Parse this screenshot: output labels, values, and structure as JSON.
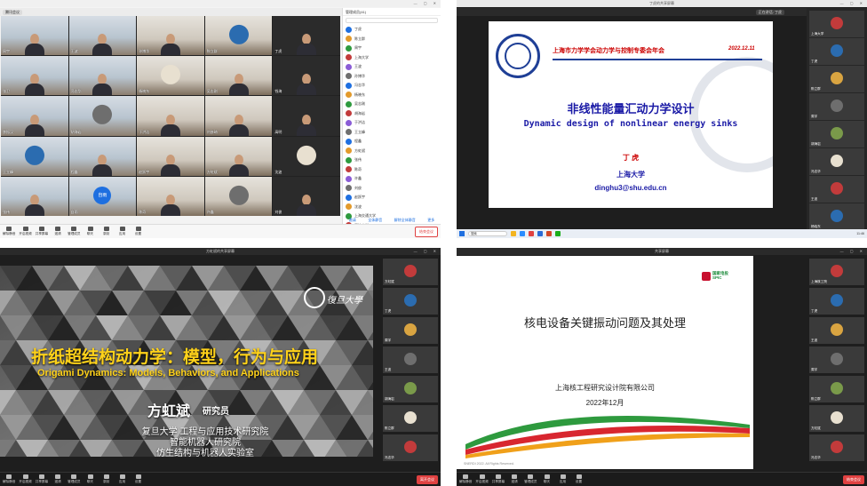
{
  "panel1": {
    "meeting_badge": "腾讯会议",
    "participants_header": "管理成员(41)",
    "tiles": [
      {
        "name": "周宇"
      },
      {
        "name": "王波"
      },
      {
        "name": "孙博华"
      },
      {
        "name": "陈立群"
      },
      {
        "name": "丁虎"
      },
      {
        "name": "张卫"
      },
      {
        "name": "冯志华"
      },
      {
        "name": "杨晓东"
      },
      {
        "name": "吴志刚"
      },
      {
        "name": "钱海"
      },
      {
        "name": "李振汉"
      },
      {
        "name": "胡海岩"
      },
      {
        "name": "于洪洁"
      },
      {
        "name": "刘彦琦"
      },
      {
        "name": "高明"
      },
      {
        "name": "王立峰"
      },
      {
        "name": "程鑫"
      },
      {
        "name": "赵跃宇"
      },
      {
        "name": "方虹斌"
      },
      {
        "name": "沈波"
      },
      {
        "name": "张伟"
      },
      {
        "name": "自雨",
        "avatar_text": "自雨"
      },
      {
        "name": "陈奇"
      },
      {
        "name": "许鑫"
      },
      {
        "name": "刘俊"
      }
    ],
    "participants": [
      "丁虎",
      "陈立群",
      "周宇",
      "上海大学",
      "王波",
      "孙博华",
      "冯志华",
      "杨晓东",
      "吴志刚",
      "胡海岩",
      "于洪洁",
      "王立峰",
      "程鑫",
      "方虹斌",
      "张伟",
      "陈奇",
      "许鑫",
      "刘俊",
      "赵跃宇",
      "沈波",
      "上海交通大学",
      "同济大学"
    ],
    "list_buttons": [
      "邀请",
      "全体静音",
      "解除全体静音",
      "更多"
    ],
    "toolbar": [
      "解除静音",
      "开启视频",
      "共享屏幕",
      "邀请",
      "管理成员",
      "聊天",
      "录制",
      "应用",
      "设置"
    ],
    "leave": "结束会议"
  },
  "panel2": {
    "window_title": "丁虎的共享屏幕",
    "badge": "正在讲话: 丁虎",
    "slide": {
      "header": "上海市力学学会动力学与控制专委会年会",
      "date": "2022.12.11",
      "title_cn": "非线性能量汇动力学设计",
      "title_en": "Dynamic design of nonlinear energy sinks",
      "author": "丁 虎",
      "affiliation": "上海大学",
      "email": "dinghu3@shu.edu.cn"
    },
    "taskbar_search": "搜索",
    "time": "11:46",
    "side": [
      "上海大学",
      "丁虎",
      "陈立群",
      "周宇",
      "胡海岩",
      "冯志华",
      "王波",
      "杨晓东"
    ]
  },
  "panel3": {
    "window_title": "方虹斌的共享屏幕",
    "slide": {
      "title_cn": "折纸超结构动力学：模型，行为与应用",
      "title_en": "Origami Dynamics: Models, Behaviors, and Applications",
      "speaker": "方虹斌",
      "role": "研究员",
      "affiliations": [
        "复旦大学 工程与应用技术研究院",
        "智能机器人研究院",
        "仿生结构与机器人实验室"
      ],
      "logo_text": "復旦大學"
    },
    "side": [
      "方虹斌",
      "丁虎",
      "周宇",
      "王波",
      "胡海岩",
      "陈立群",
      "冯志华"
    ],
    "toolbar": [
      "解除静音",
      "开启视频",
      "共享屏幕",
      "邀请",
      "管理成员",
      "聊天",
      "录制",
      "应用",
      "设置"
    ],
    "leave": "离开会议"
  },
  "panel4": {
    "window_title": "共享屏幕",
    "slide": {
      "logo_line1": "国家电投",
      "logo_line2": "SPIC",
      "title": "核电设备关键振动问题及其处理",
      "company": "上海核工程研究设计院有限公司",
      "date": "2022年12月",
      "copyright": "SNERDI 2022. All Rights Reserved."
    },
    "side": [
      "上海核工院",
      "丁虎",
      "王波",
      "周宇",
      "陈立群",
      "方虹斌",
      "冯志华"
    ],
    "toolbar": [
      "解除静音",
      "开启视频",
      "共享屏幕",
      "邀请",
      "管理成员",
      "聊天",
      "应用",
      "设置"
    ],
    "leave": "结束会议"
  }
}
